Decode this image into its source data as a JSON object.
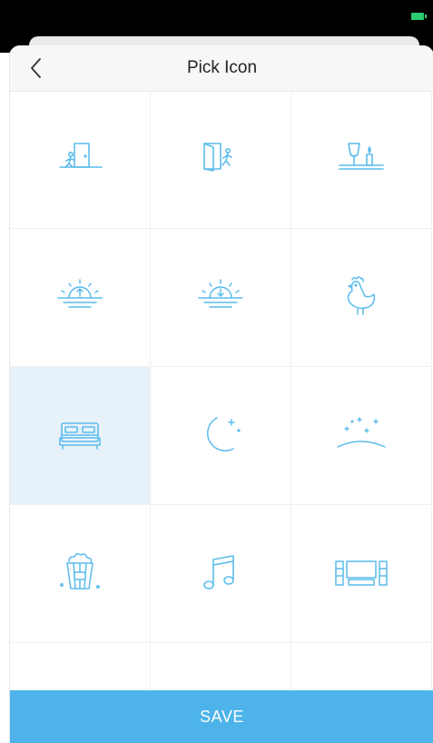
{
  "header": {
    "title": "Pick Icon"
  },
  "icons": [
    {
      "name": "leave-home-icon",
      "selected": false
    },
    {
      "name": "walk-out-door-icon",
      "selected": false
    },
    {
      "name": "dinner-table-icon",
      "selected": false
    },
    {
      "name": "sunrise-icon",
      "selected": false
    },
    {
      "name": "sunset-icon",
      "selected": false
    },
    {
      "name": "rooster-icon",
      "selected": false
    },
    {
      "name": "bed-icon",
      "selected": true
    },
    {
      "name": "moon-stars-icon",
      "selected": false
    },
    {
      "name": "night-sky-icon",
      "selected": false
    },
    {
      "name": "popcorn-icon",
      "selected": false
    },
    {
      "name": "music-note-icon",
      "selected": false
    },
    {
      "name": "home-theater-icon",
      "selected": false
    }
  ],
  "footer": {
    "save_label": "SAVE"
  },
  "colors": {
    "accent": "#4db3ea",
    "icon": "#5bbcec",
    "selected_bg": "#e7f1fa"
  }
}
